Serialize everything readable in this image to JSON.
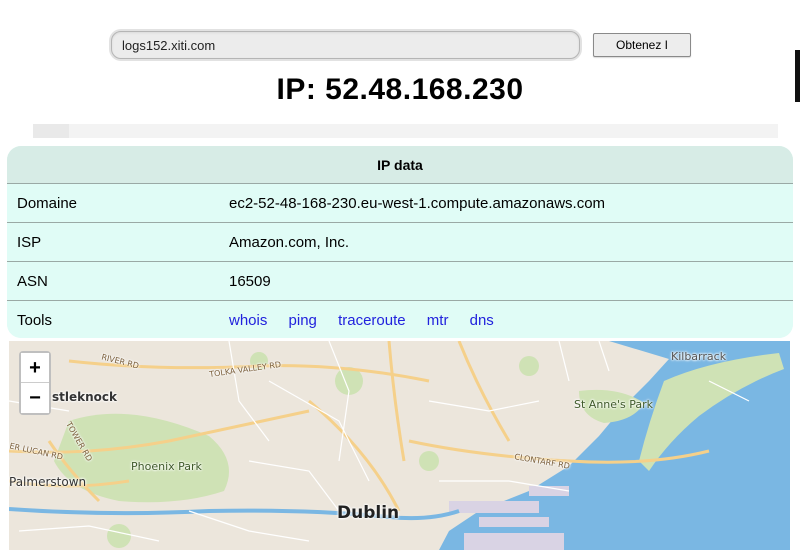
{
  "search": {
    "value": "logs152.xiti.com",
    "button_label": "Obtenez I"
  },
  "ip_heading": "IP: 52.48.168.230",
  "card": {
    "title": "IP data",
    "rows": [
      {
        "label": "Domaine",
        "value": "ec2-52-48-168-230.eu-west-1.compute.amazonaws.com"
      },
      {
        "label": "ISP",
        "value": "Amazon.com, Inc."
      },
      {
        "label": "ASN",
        "value": "16509"
      }
    ],
    "tools_label": "Tools",
    "tools": [
      "whois",
      "ping",
      "traceroute",
      "mtr",
      "dns"
    ]
  },
  "map": {
    "zoom_in": "+",
    "zoom_out": "−",
    "labels": {
      "dublin": "Dublin",
      "castleknock": "stleknock",
      "phoenix_park": "Phoenix Park",
      "palmerstown": "Palmerstown",
      "kilbarrack": "Kilbarrack",
      "st_annes_park": "St Anne's Park",
      "river_rd": "RIVER RD",
      "tolka_valley_rd": "TOLKA VALLEY RD",
      "clontarf_rd": "CLONTARF RD",
      "lucan_rd": "ER LUCAN RD",
      "tower_rd": "TOWER RD"
    },
    "colors": {
      "sea": "#7ab7e3",
      "land": "#ece6dc",
      "park": "#cfe2b5",
      "road": "#f5d08a"
    }
  }
}
